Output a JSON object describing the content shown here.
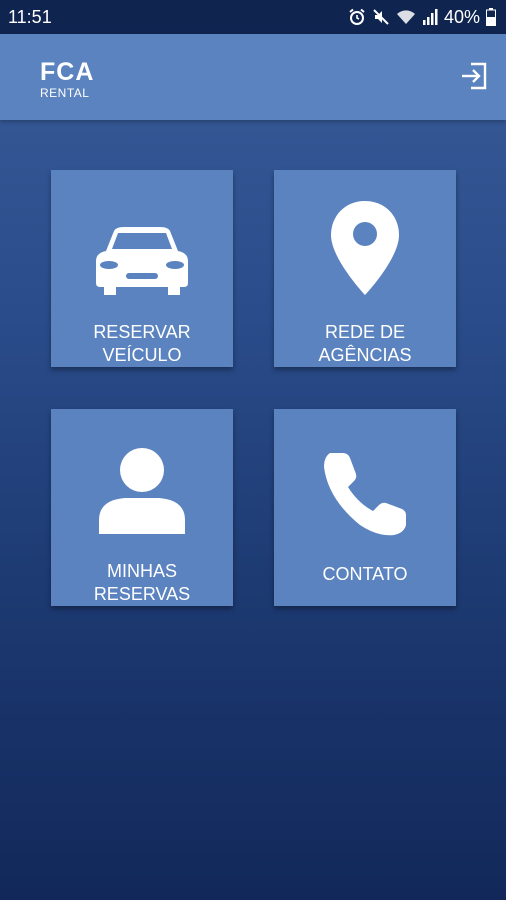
{
  "status_bar": {
    "time": "11:51",
    "battery": "40%",
    "icons": [
      "alarm-icon",
      "mute-icon",
      "wifi-icon",
      "signal-icon",
      "battery-icon"
    ]
  },
  "header": {
    "logo_main": "FCA",
    "logo_sub": "RENTAL",
    "logout_icon": "logout-icon"
  },
  "menu": {
    "tiles": [
      {
        "line1": "RESERVAR",
        "line2": "VEÍCULO",
        "icon": "car-icon"
      },
      {
        "line1": "REDE DE",
        "line2": "AGÊNCIAS",
        "icon": "location-pin-icon"
      },
      {
        "line1": "MINHAS",
        "line2": "RESERVAS",
        "icon": "user-icon"
      },
      {
        "line1": "CONTATO",
        "line2": "",
        "icon": "phone-icon"
      }
    ]
  },
  "colors": {
    "tile": "#5b83c0",
    "status_bar": "#0f2550",
    "gradient_top": "#3a5d9a",
    "gradient_bottom": "#12285a"
  }
}
